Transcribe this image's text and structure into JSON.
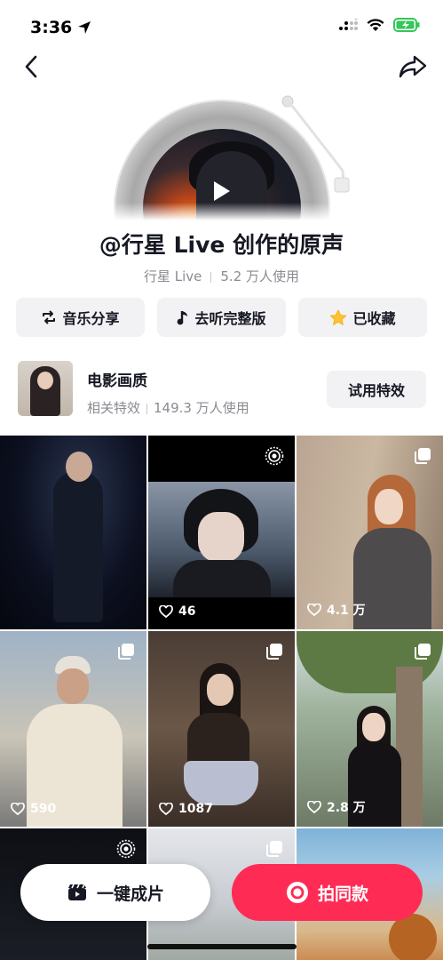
{
  "status_bar": {
    "time": "3:36"
  },
  "sound": {
    "title": "@行星 Live 创作的原声",
    "author": "行星 Live",
    "usage": "5.2 万人使用"
  },
  "actions": [
    {
      "label": "音乐分享",
      "icon": "repost-icon"
    },
    {
      "label": "去听完整版",
      "icon": "music-note-icon"
    },
    {
      "label": "已收藏",
      "icon": "star-icon",
      "icon_color": "#fec230"
    }
  ],
  "effect": {
    "name": "电影画质",
    "category": "相关特效",
    "usage": "149.3 万人使用",
    "button": "试用特效"
  },
  "videos": [
    {
      "likes": "",
      "badge": ""
    },
    {
      "likes": "46",
      "badge": "live-photo-icon"
    },
    {
      "likes": "4.1 万",
      "badge": "multi-image-icon"
    },
    {
      "likes": "590",
      "badge": "multi-image-icon"
    },
    {
      "likes": "1087",
      "badge": "multi-image-icon"
    },
    {
      "likes": "2.8 万",
      "badge": "multi-image-icon"
    },
    {
      "likes": "",
      "badge": "live-photo-icon"
    },
    {
      "likes": "",
      "badge": "multi-image-icon"
    },
    {
      "likes": "",
      "badge": ""
    }
  ],
  "bottom": {
    "template_label": "一键成片",
    "shoot_label": "拍同款"
  },
  "colors": {
    "accent": "#fe2c55",
    "text": "#161823",
    "muted": "#8a8b91"
  }
}
